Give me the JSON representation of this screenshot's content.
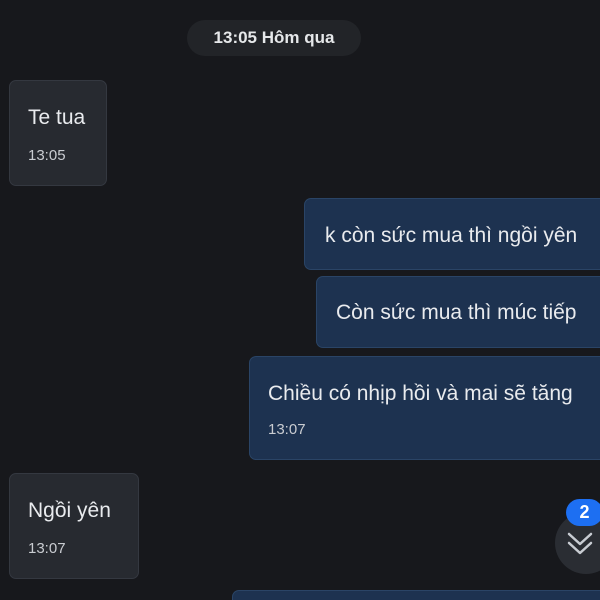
{
  "date_separator": "13:05 Hôm qua",
  "messages": [
    {
      "direction": "incoming",
      "text": "Te tua",
      "time": "13:05"
    },
    {
      "direction": "outgoing",
      "text": "k còn sức mua thì ngồi yên",
      "time": ""
    },
    {
      "direction": "outgoing",
      "text": "Còn sức mua thì múc tiếp",
      "time": ""
    },
    {
      "direction": "outgoing",
      "text": "Chiều có nhịp hồi và mai sẽ tăng",
      "time": "13:07"
    },
    {
      "direction": "incoming",
      "text": "Ngồi yên",
      "time": "13:07"
    }
  ],
  "scroll_down": {
    "icon": "double-chevron-down-icon",
    "unread_count": "2"
  },
  "colors": {
    "background": "#17181c",
    "incoming_bubble": "#272a30",
    "outgoing_bubble": "#1d3250",
    "badge": "#1d6ff2"
  }
}
